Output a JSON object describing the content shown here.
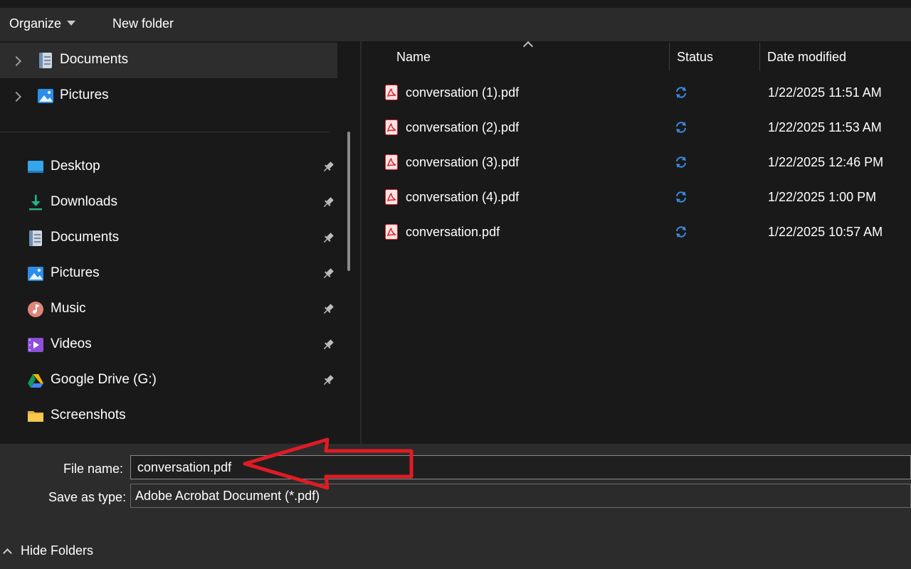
{
  "toolbar": {
    "organize_label": "Organize",
    "new_folder_label": "New folder"
  },
  "nav": {
    "tree_items": [
      {
        "label": "Documents",
        "icon": "documents-icon",
        "selected": true
      },
      {
        "label": "Pictures",
        "icon": "pictures-icon",
        "selected": false
      }
    ],
    "quick_access": [
      {
        "label": "Desktop",
        "icon": "desktop-icon",
        "pinned": true
      },
      {
        "label": "Downloads",
        "icon": "downloads-icon",
        "pinned": true
      },
      {
        "label": "Documents",
        "icon": "documents-icon",
        "pinned": true
      },
      {
        "label": "Pictures",
        "icon": "pictures-icon",
        "pinned": true
      },
      {
        "label": "Music",
        "icon": "music-icon",
        "pinned": true
      },
      {
        "label": "Videos",
        "icon": "videos-icon",
        "pinned": true
      },
      {
        "label": "Google Drive (G:)",
        "icon": "google-drive-icon",
        "pinned": true
      },
      {
        "label": "Screenshots",
        "icon": "folder-icon",
        "pinned": false
      }
    ]
  },
  "file_list": {
    "columns": {
      "name": "Name",
      "status": "Status",
      "date": "Date modified"
    },
    "files": [
      {
        "name": "conversation (1).pdf",
        "status_icon": "sync-icon",
        "date": "1/22/2025 11:51 AM"
      },
      {
        "name": "conversation (2).pdf",
        "status_icon": "sync-icon",
        "date": "1/22/2025 11:53 AM"
      },
      {
        "name": "conversation (3).pdf",
        "status_icon": "sync-icon",
        "date": "1/22/2025 12:46 PM"
      },
      {
        "name": "conversation (4).pdf",
        "status_icon": "sync-icon",
        "date": "1/22/2025 1:00 PM"
      },
      {
        "name": "conversation.pdf",
        "status_icon": "sync-icon",
        "date": "1/22/2025 10:57 AM"
      }
    ]
  },
  "save_panel": {
    "file_name_label": "File name:",
    "file_name_value": "conversation.pdf",
    "save_type_label": "Save as type:",
    "save_type_value": "Adobe Acrobat Document (*.pdf)",
    "hide_folders_label": "Hide Folders"
  },
  "colors": {
    "background": "#191919",
    "toolbar": "#2b2b2b",
    "selected_row": "#2d2d2d",
    "pdf_red": "#e0232a",
    "sync_blue": "#3c8be0",
    "annotation_red": "#e01b24"
  }
}
